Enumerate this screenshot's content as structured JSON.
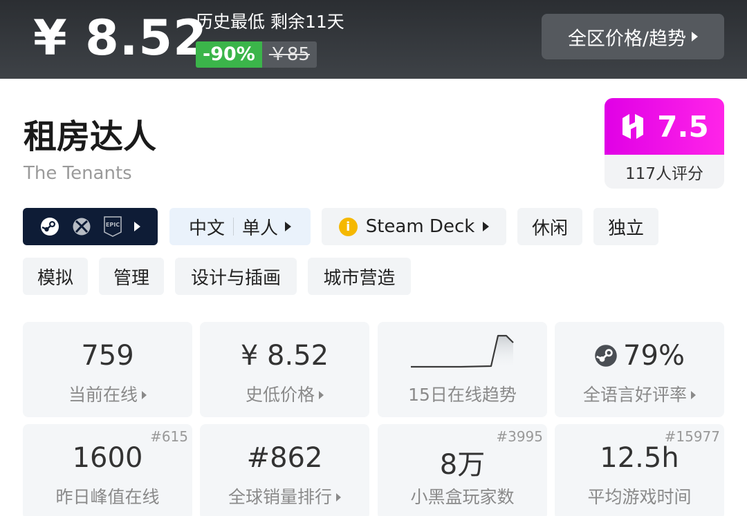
{
  "price_bar": {
    "current_price": "¥ 8.52",
    "note": "历史最低 剩余11天",
    "discount": "-90%",
    "original_price": "￥85",
    "region_button_label": "全区价格/趋势"
  },
  "game": {
    "title": "租房达人",
    "subtitle": "The Tenants"
  },
  "score": {
    "value": "7.5",
    "count": "117人评分",
    "brand_color": "#e800e8"
  },
  "platforms": {
    "icons": [
      "steam-icon",
      "xbox-icon",
      "epic-games-icon"
    ],
    "epic_label": "EPIC"
  },
  "tags": {
    "language": "中文",
    "players": "单人",
    "steam_deck": "Steam Deck",
    "info_mark": "i",
    "genres": [
      "休闲",
      "独立",
      "模拟",
      "管理",
      "设计与插画",
      "城市营造"
    ]
  },
  "stats": [
    {
      "value": "759",
      "label": "当前在线",
      "rank": ""
    },
    {
      "value": "¥ 8.52",
      "label": "史低价格",
      "rank": ""
    },
    {
      "value": "",
      "label": "15日在线趋势",
      "rank": ""
    },
    {
      "value": "79%",
      "label": "全语言好评率",
      "rank": ""
    },
    {
      "value": "1600",
      "label": "昨日峰值在线",
      "rank": "#615"
    },
    {
      "value": "#862",
      "label": "全球销量排行",
      "rank": ""
    },
    {
      "value": "8万",
      "label": "小黑盒玩家数",
      "rank": "#3995"
    },
    {
      "value": "12.5h",
      "label": "平均游戏时间",
      "rank": "#15977"
    }
  ],
  "colors": {
    "header_bg": "#2f3236",
    "discount_green": "#3bb54a",
    "platform_tag_bg": "#0e1c36",
    "steam_deck_dot": "#f5b800"
  }
}
